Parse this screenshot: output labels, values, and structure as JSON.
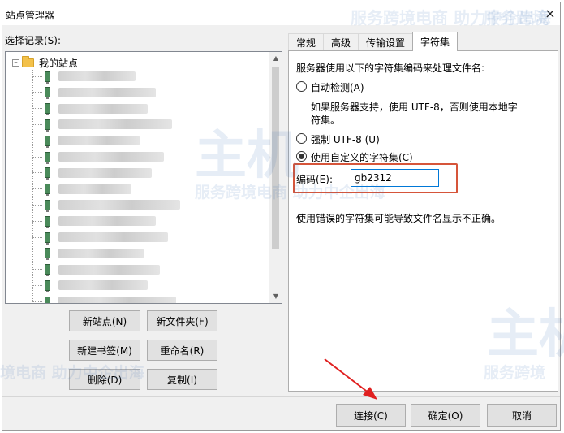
{
  "window": {
    "title": "站点管理器",
    "close_glyph": "×"
  },
  "select_label": "选择记录(S):",
  "tree": {
    "root_label": "我的站点",
    "expander_glyph": "–",
    "site_count": 15
  },
  "left_buttons": {
    "new_site": "新站点(N)",
    "new_folder": "新文件夹(F)",
    "new_bookmark": "新建书签(M)",
    "rename": "重命名(R)",
    "delete": "删除(D)",
    "copy": "复制(I)"
  },
  "tabs": [
    {
      "label": "常规",
      "active": false
    },
    {
      "label": "高级",
      "active": false
    },
    {
      "label": "传输设置",
      "active": false
    },
    {
      "label": "字符集",
      "active": true
    }
  ],
  "charset": {
    "intro": "服务器使用以下的字符集编码来处理文件名:",
    "auto_detect_label": "自动检测(A)",
    "auto_detect_note_line1": "如果服务器支持，使用 UTF-8，否则使用本地字",
    "auto_detect_note_line2": "符集。",
    "force_utf8_label": "强制 UTF-8 (U)",
    "custom_label": "使用自定义的字符集(C)",
    "selected_option": "custom",
    "encoding_label": "编码(E):",
    "encoding_value": "gb2312",
    "warning": "使用错误的字符集可能导致文件名显示不正确。"
  },
  "bottom_buttons": {
    "connect": "连接(C)",
    "ok": "确定(O)",
    "cancel": "取消"
  },
  "annotation": {
    "highlight_color": "#d6553a",
    "arrow_color": "#e02020"
  },
  "watermark": {
    "slogan": "服务跨境电商 助力中企出海",
    "short1": "服务跨境",
    "short2": "境电商 助力中企出海",
    "brand": "主机",
    "brand2": "主机"
  }
}
